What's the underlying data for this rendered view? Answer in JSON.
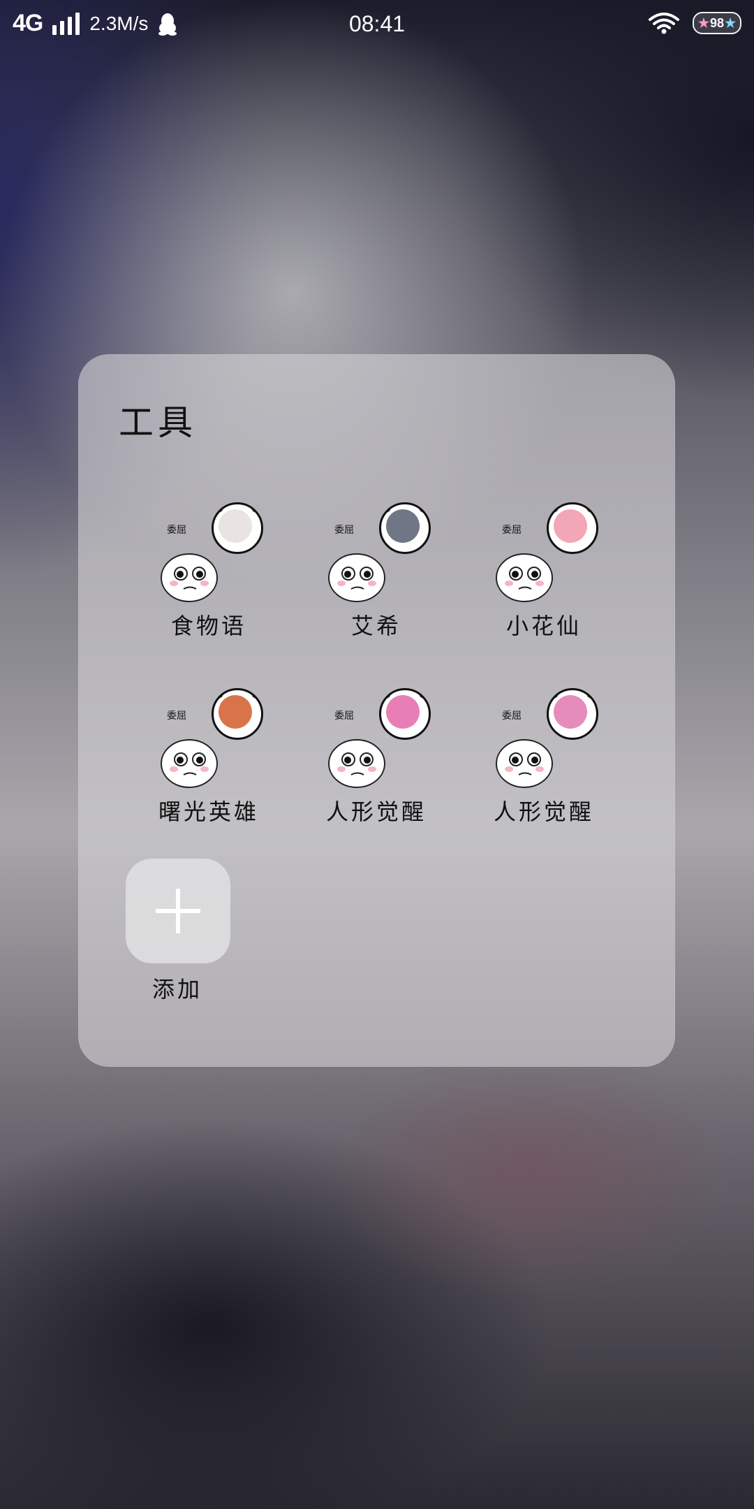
{
  "status_bar": {
    "network": "4G",
    "signal_icon": "signal-bars-icon",
    "speed": "2.3M/s",
    "qq_icon": "penguin-icon",
    "time": "08:41",
    "wifi_icon": "wifi-icon",
    "battery_level": "98",
    "battery_icon": "battery-icon"
  },
  "folder": {
    "title": "工具",
    "apps": [
      {
        "label": "食物语",
        "icon": "meme-avatar-icon",
        "face_color": "#e9e4e2"
      },
      {
        "label": "艾希",
        "icon": "meme-avatar-icon",
        "face_color": "#6f7786"
      },
      {
        "label": "小花仙",
        "icon": "meme-avatar-icon",
        "face_color": "#f3a6b6"
      },
      {
        "label": "曙光英雄",
        "icon": "meme-avatar-icon",
        "face_color": "#d9744a"
      },
      {
        "label": "人形觉醒",
        "icon": "meme-avatar-icon",
        "face_color": "#e77fb6"
      },
      {
        "label": "人形觉醒",
        "icon": "meme-avatar-icon",
        "face_color": "#e58cbc"
      }
    ],
    "add_label": "添加",
    "add_icon": "plus-icon"
  },
  "colors": {
    "panel": "#d2d0d4",
    "text": "#111111",
    "status_text": "#ffffff"
  }
}
